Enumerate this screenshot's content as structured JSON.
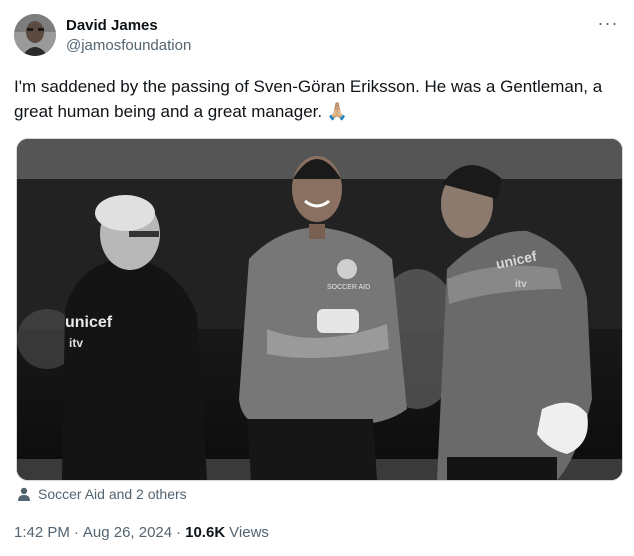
{
  "author": {
    "display_name": "David James",
    "handle": "@jamosfoundation",
    "avatar": "profile-photo"
  },
  "more_icon": "more-horizontal-icon",
  "tweet": {
    "text": "I'm saddened by the passing of Sven-Göran Eriksson. He was a Gentleman, a great human being and a great manager. 🙏🏼"
  },
  "media": {
    "description_icon": "photo",
    "left_logo": "unicef",
    "left_sub": "itv",
    "center_logo": "SOCCER AID",
    "right_logo": "unicef",
    "right_sub": "itv"
  },
  "tagged": {
    "icon": "person-icon",
    "label": "Soccer Aid and 2 others"
  },
  "meta": {
    "time": "1:42 PM",
    "separator": "·",
    "date": "Aug 26, 2024",
    "views_count": "10.6K",
    "views_label": "Views"
  }
}
